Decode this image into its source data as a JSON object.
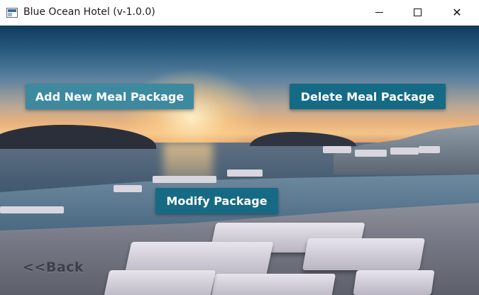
{
  "window": {
    "title": "Blue Ocean Hotel (v-1.0.0)",
    "icon": "app-window-icon",
    "controls": {
      "minimize_icon": "minimize-icon",
      "maximize_icon": "maximize-icon",
      "close_icon": "close-icon",
      "close_glyph": "✕"
    }
  },
  "background": {
    "description_icon": "sunset-pool-background-image"
  },
  "actions": {
    "add_label": "Add New Meal Package",
    "delete_label": "Delete Meal Package",
    "modify_label": "Modify Package"
  },
  "navigation": {
    "back_label": "<<Back"
  },
  "colors": {
    "add_button": "#3d8aa0",
    "delete_button": "#156b85",
    "modify_button": "#176a83",
    "back_text": "#3a3f4a"
  }
}
